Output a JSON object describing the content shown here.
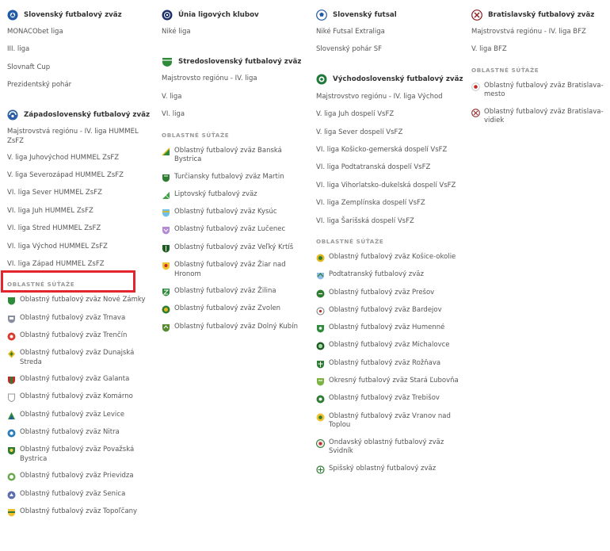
{
  "columns": {
    "col1": {
      "sections": [
        {
          "title": "Slovenský futbalový zväz",
          "logo": "sfz-logo",
          "links": [
            "MONACObet liga",
            "III. liga",
            "Slovnaft Cup",
            "Prezidentský pohár"
          ]
        },
        {
          "title": "Západoslovenský futbalový zväz",
          "logo": "zsfz-logo",
          "links": [
            "Majstrovstvá regiónu - IV. liga HUMMEL ZsFZ",
            "V. liga Juhovýchod HUMMEL ZsFZ",
            "V. liga Severozápad HUMMEL ZsFZ",
            "VI. liga Sever HUMMEL ZsFZ",
            "VI. liga Juh HUMMEL ZsFZ",
            "VI. liga Stred HUMMEL ZsFZ",
            "VI. liga Východ HUMMEL ZsFZ",
            "VI. liga Západ HUMMEL ZsFZ"
          ],
          "sub_title": "OBLASTNÉ SÚŤAŽE",
          "regions": [
            "Oblastný futbalový zväz Nové Zámky",
            "Oblastný futbalový zväz Trnava",
            "Oblastný futbalový zväz Trenčín",
            "Oblastný futbalový zväz Dunajská Streda",
            "Oblastný futbalový zväz Galanta",
            "Oblastný futbalový zväz Komárno",
            "Oblastný futbalový zväz Levice",
            "Oblastný futbalový zväz Nitra",
            "Oblastný futbalový zväz Považská Bystrica",
            "Oblastný futbalový zväz Prievidza",
            "Oblastný futbalový zväz Senica",
            "Oblastný futbalový zväz Topoľčany"
          ]
        }
      ]
    },
    "col2": {
      "sections": [
        {
          "title": "Únia ligových klubov",
          "logo": "ulk-logo",
          "links": [
            "Niké liga"
          ]
        },
        {
          "title": "Stredoslovenský futbalový zväz",
          "logo": "ssfz-logo",
          "links": [
            "Majstrovsto regiónu - IV. liga",
            "V. liga",
            "VI. liga"
          ],
          "sub_title": "OBLASTNÉ SÚŤAŽE",
          "regions": [
            "Oblastný futbalový zväz Banská Bystrica",
            "Turčiansky futbalový zväz Martin",
            "Liptovský futbalový zväz",
            "Oblastný futbalový zväz Kysúc",
            "Oblastný futbalový zväz Lučenec",
            "Oblastný futbalový zväz Veľký Krtíš",
            "Oblastný futbalový zväz Žiar nad Hronom",
            "Oblastný futbalový zväz Žilina",
            "Oblastný futbalový zväz Zvolen",
            "Oblastný futbalový zväz Dolný Kubín"
          ]
        }
      ]
    },
    "col3": {
      "sections": [
        {
          "title": "Slovenský futsal",
          "logo": "futsal-logo",
          "links": [
            "Niké Futsal Extraliga",
            "Slovenský pohár SF"
          ]
        },
        {
          "title": "Východoslovenský futbalový zväz",
          "logo": "vsfz-logo",
          "links": [
            "Majstrovstvo regiónu - IV. liga Východ",
            "V. liga Juh dospelí VsFZ",
            "V. liga Sever dospelí VsFZ",
            "VI. liga Košicko-gemerská dospelí VsFZ",
            "VI. liga Podtatranská dospelí VsFZ",
            "VI. liga Vihorlatsko-dukelská dospelí VsFZ",
            "VI. liga Zemplínska dospelí VsFZ",
            "VI. liga Šarišská dospelí VsFZ"
          ],
          "sub_title": "OBLASTNÉ SÚŤAŽE",
          "regions": [
            "Oblastný futbalový zväz Košice-okolie",
            "Podtatranský futbalový zväz",
            "Oblastný futbalový zväz Prešov",
            "Oblastný futbalový zväz Bardejov",
            "Oblastný futbalový zväz Humenné",
            "Oblastný futbalový zväz Michalovce",
            "Oblastný futbalový zväz Rožňava",
            "Okresný futbalový zväz Stará Ľubovňa",
            "Oblastný futbalový zväz Trebišov",
            "Oblastný futbalový zväz Vranov nad Toplou",
            "Ondavský oblastný futbalový zväz Svidník",
            "Spišský oblastný futbalový zväz"
          ]
        }
      ]
    },
    "col4": {
      "sections": [
        {
          "title": "Bratislavský futbalový zväz",
          "logo": "bfz-logo",
          "links": [
            "Majstrovstvá regiónu - IV. liga BFZ",
            "V. liga BFZ"
          ],
          "sub_title": "OBLASTNÉ SÚŤAŽE",
          "regions": [
            "Oblastný futbalový zväz Bratislava-mesto",
            "Oblastný futbalový zväz Bratislava-vidiek"
          ]
        }
      ]
    }
  },
  "highlighted_link": "VI. liga Západ HUMMEL ZsFZ",
  "colors": {
    "highlight": "#e3262d",
    "text": "#555555",
    "heading": "#333333",
    "subheading": "#999999"
  }
}
